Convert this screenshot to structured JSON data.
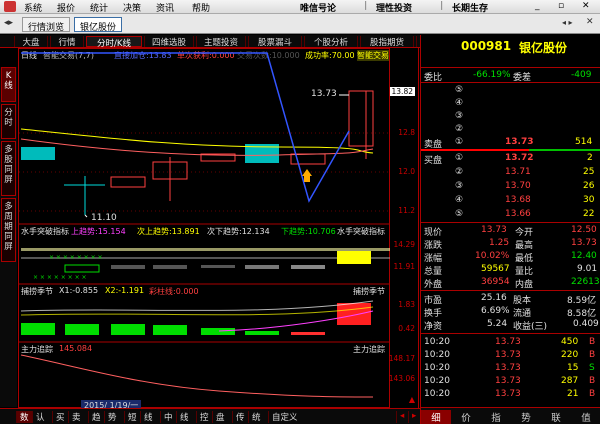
{
  "menu": {
    "items": [
      "系统",
      "报价",
      "统计",
      "决策",
      "资讯",
      "帮助"
    ],
    "slogans": [
      "唯信号论",
      "理性投资",
      "长期生存"
    ]
  },
  "doc_tabs": [
    "行情浏览",
    "银亿股份"
  ],
  "func_tabs": [
    "大盘",
    "行情",
    "分时/K线",
    "四维选股",
    "主题投资",
    "股票漏斗",
    "个股分析",
    "股指期货",
    "资讯"
  ],
  "left_tabs": [
    "K线",
    "分时",
    "多股同屏",
    "多周期同屏"
  ],
  "kline": {
    "period_label": "日线",
    "indicator_name": "智能交易(7,7)",
    "buy_label": "直接加仓:13.83",
    "profit_label": "单次获利:0.000",
    "trades_label": "交易次数:10.000",
    "win_label": "成功率:70.00",
    "mode_label": "智能交易",
    "high_mark": "13.73",
    "low_mark": "11.10",
    "price_box": "13.82",
    "axis": [
      "12.8",
      "12.0",
      "11.2"
    ]
  },
  "trend_panel": {
    "title": "水手突破指标",
    "up": "上趋势:15.154",
    "next_up": "次上趋势:13.891",
    "next_down": "次下趋势:12.134",
    "down": "下趋势:10.706",
    "right_title": "水手突破指标",
    "axis": [
      "14.29",
      "11.91"
    ]
  },
  "season_panel": {
    "title": "捕捞季节",
    "x1": "X1:-0.855",
    "x2": "X2:-1.191",
    "col": "彩柱线:0.000",
    "right_title": "捕捞季节",
    "axis": [
      "1.83",
      "0.42"
    ]
  },
  "main_panel": {
    "title": "主力追踪",
    "value": "145.084",
    "right_title": "主力追踪",
    "axis": [
      "148.17",
      "143.06"
    ],
    "date": "2015/ 1/19/一"
  },
  "bottom_tabs": [
    "数",
    "认",
    "买",
    "卖",
    "趋",
    "势",
    "短",
    "线",
    "中",
    "线",
    "控",
    "盘",
    "传",
    "统",
    "自定义"
  ],
  "quote": {
    "code": "000981",
    "name": "银亿股份",
    "weibi_label": "委比",
    "weibi": "-66.19%",
    "weicha_label": "委差",
    "weicha": "-409",
    "sell_label": "卖盘",
    "buy_label": "买盘",
    "sell": [
      {
        "n": "⑤",
        "p": "",
        "v": ""
      },
      {
        "n": "④",
        "p": "",
        "v": ""
      },
      {
        "n": "③",
        "p": "",
        "v": ""
      },
      {
        "n": "②",
        "p": "",
        "v": ""
      },
      {
        "n": "①",
        "p": "13.73",
        "v": "514"
      }
    ],
    "buy": [
      {
        "n": "①",
        "p": "13.72",
        "v": "2"
      },
      {
        "n": "②",
        "p": "13.71",
        "v": "25"
      },
      {
        "n": "③",
        "p": "13.70",
        "v": "26"
      },
      {
        "n": "④",
        "p": "13.68",
        "v": "30"
      },
      {
        "n": "⑤",
        "p": "13.66",
        "v": "22"
      }
    ],
    "stats": [
      {
        "l1": "现价",
        "v1": "13.73",
        "c1": "red",
        "l2": "今开",
        "v2": "12.50",
        "c2": "red"
      },
      {
        "l1": "涨跌",
        "v1": "1.25",
        "c1": "red",
        "l2": "最高",
        "v2": "13.73",
        "c2": "red"
      },
      {
        "l1": "涨幅",
        "v1": "10.02%",
        "c1": "red",
        "l2": "最低",
        "v2": "12.40",
        "c2": "green"
      },
      {
        "l1": "总量",
        "v1": "59567",
        "c1": "yellow",
        "l2": "量比",
        "v2": "9.01",
        "c2": "white"
      },
      {
        "l1": "外盘",
        "v1": "36954",
        "c1": "red",
        "l2": "内盘",
        "v2": "22613",
        "c2": "green"
      }
    ],
    "stats2": [
      {
        "l1": "市盈",
        "v1": "25.16",
        "l2": "股本",
        "v2": "8.59亿"
      },
      {
        "l1": "换手",
        "v1": "6.69%",
        "l2": "流通",
        "v2": "8.58亿"
      },
      {
        "l1": "净资",
        "v1": "5.24",
        "l2": "收益(三)",
        "v2": "0.409"
      }
    ],
    "ticks": [
      {
        "t": "10:20",
        "p": "13.73",
        "v": "450",
        "d": "B",
        "dc": "red"
      },
      {
        "t": "10:20",
        "p": "13.73",
        "v": "220",
        "d": "B",
        "dc": "red"
      },
      {
        "t": "10:20",
        "p": "13.73",
        "v": "15",
        "d": "S",
        "dc": "green"
      },
      {
        "t": "10:20",
        "p": "13.73",
        "v": "287",
        "d": "B",
        "dc": "red"
      },
      {
        "t": "10:20",
        "p": "13.73",
        "v": "21",
        "d": "B",
        "dc": "red"
      }
    ],
    "bottom_buttons": [
      "细",
      "价",
      "指",
      "势",
      "联",
      "值"
    ]
  },
  "colors": {
    "accent_red": "#aa0000",
    "up": "#ff4040",
    "down": "#00e000",
    "highlight": "#ffff00"
  }
}
